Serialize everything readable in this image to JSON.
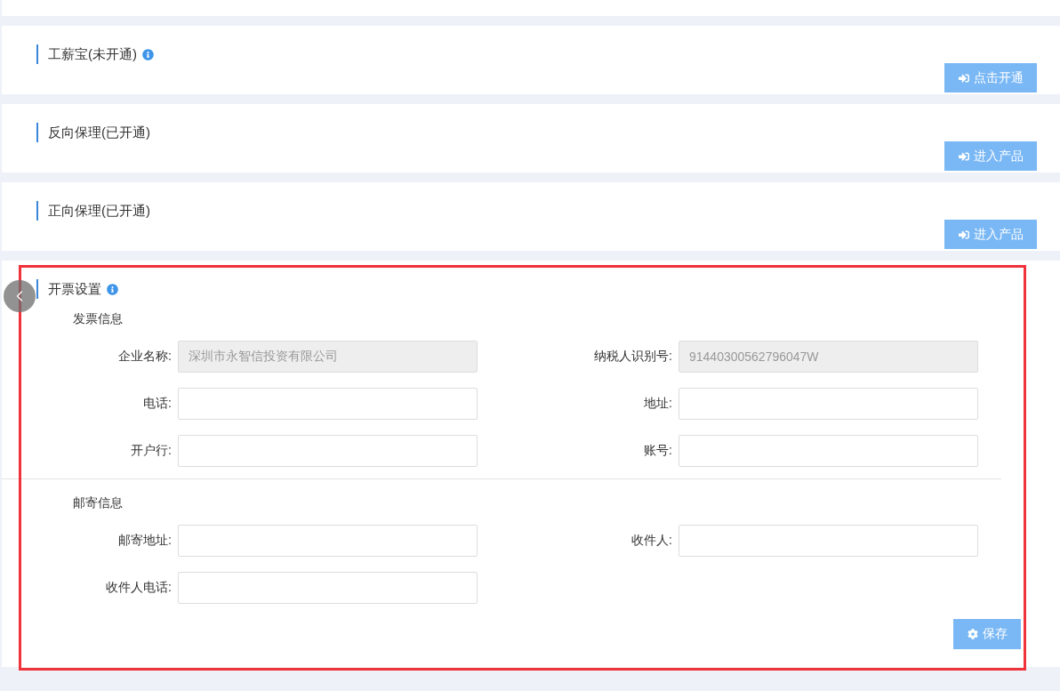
{
  "products": [
    {
      "title": "工薪宝(未开通)",
      "has_info": true,
      "button": "点击开通"
    },
    {
      "title": "反向保理(已开通)",
      "has_info": false,
      "button": "进入产品"
    },
    {
      "title": "正向保理(已开通)",
      "has_info": false,
      "button": "进入产品"
    }
  ],
  "invoice_settings": {
    "title": "开票设置",
    "has_info": true,
    "sections": [
      {
        "title": "发票信息",
        "fields": [
          {
            "label": "企业名称:",
            "value": "深圳市永智信投资有限公司",
            "disabled": true
          },
          {
            "label": "纳税人识别号:",
            "value": "91440300562796047W",
            "disabled": true
          },
          {
            "label": "电话:",
            "disabled": false
          },
          {
            "label": "地址:",
            "disabled": false
          },
          {
            "label": "开户行:",
            "disabled": false
          },
          {
            "label": "账号:",
            "disabled": false
          }
        ]
      },
      {
        "title": "邮寄信息",
        "fields": [
          {
            "label": "邮寄地址:",
            "disabled": false
          },
          {
            "label": "收件人:",
            "disabled": false
          },
          {
            "label": "收件人电话:",
            "disabled": false
          }
        ]
      }
    ],
    "save_button": "保存"
  }
}
